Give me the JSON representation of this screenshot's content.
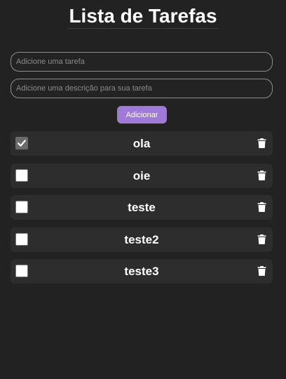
{
  "header": {
    "title": "Lista de Tarefas"
  },
  "form": {
    "task_placeholder": "Adicione uma tarefa",
    "description_placeholder": "Adicione uma descrição para sua tarefa",
    "add_label": "Adicionar"
  },
  "tasks": [
    {
      "name": "ola",
      "checked": true
    },
    {
      "name": "oie",
      "checked": false
    },
    {
      "name": "teste",
      "checked": false
    },
    {
      "name": "teste2",
      "checked": false
    },
    {
      "name": "teste3",
      "checked": false
    }
  ],
  "icons": {
    "check": "check-icon",
    "delete": "trash-icon"
  },
  "colors": {
    "background": "#222222",
    "row_background": "#2d2d2d",
    "accent": "#9f7ad8"
  }
}
